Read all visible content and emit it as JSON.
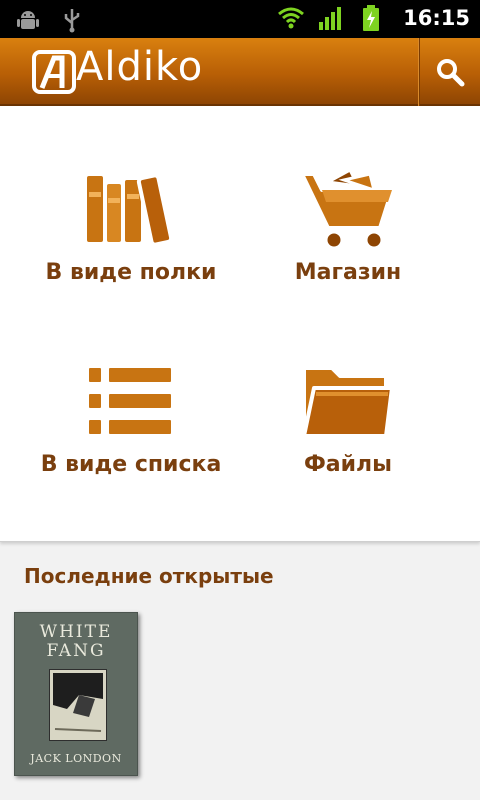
{
  "status_bar": {
    "time": "16:15",
    "icons": [
      "android-debug-icon",
      "usb-icon",
      "wifi-icon",
      "signal-icon",
      "battery-charging-icon"
    ]
  },
  "app": {
    "name": "Aldiko",
    "search_icon": "search-icon"
  },
  "menu": [
    {
      "label": "В виде полки",
      "icon": "bookshelf-icon"
    },
    {
      "label": "Магазин",
      "icon": "shopping-cart-icon"
    },
    {
      "label": "В виде списка",
      "icon": "list-icon"
    },
    {
      "label": "Файлы",
      "icon": "folder-icon"
    }
  ],
  "recent": {
    "title": "Последние открытые",
    "books": [
      {
        "title_line1": "WHITE",
        "title_line2": "FANG",
        "author": "JACK LONDON"
      }
    ]
  },
  "colors": {
    "accent": "#b8600a",
    "label": "#7a3f0e",
    "header_top": "#d9800f",
    "header_bottom": "#8e4503"
  }
}
